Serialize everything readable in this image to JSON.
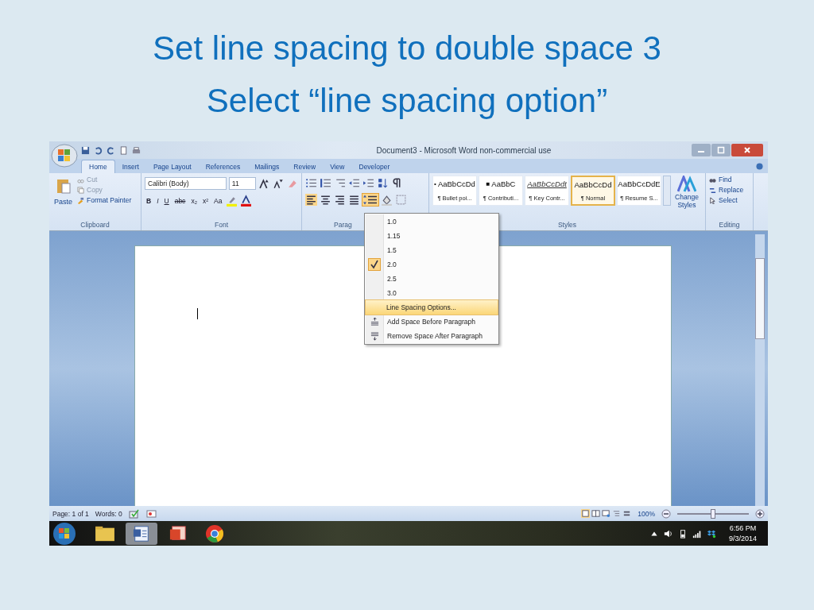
{
  "slide": {
    "title_lines": [
      "Set line spacing to double space 3",
      "Select “line spacing option”"
    ]
  },
  "window": {
    "title": "Document3 - Microsoft Word non-commercial use"
  },
  "ribbon_tabs": [
    {
      "label": "Home",
      "selected": true
    },
    {
      "label": "Insert",
      "selected": false
    },
    {
      "label": "Page Layout",
      "selected": false
    },
    {
      "label": "References",
      "selected": false
    },
    {
      "label": "Mailings",
      "selected": false
    },
    {
      "label": "Review",
      "selected": false
    },
    {
      "label": "View",
      "selected": false
    },
    {
      "label": "Developer",
      "selected": false
    }
  ],
  "clipboard": {
    "paste": "Paste",
    "cut": "Cut",
    "copy": "Copy",
    "format_painter": "Format Painter",
    "label": "Clipboard"
  },
  "font": {
    "font_name": "Calibri (Body)",
    "font_size": "11",
    "format_buttons": [
      "B",
      "I",
      "U",
      "abc",
      "x₂",
      "x²",
      "Aa"
    ],
    "label": "Font"
  },
  "paragraph": {
    "label": "Parag"
  },
  "styles": {
    "items": [
      {
        "marker": "•",
        "preview": "AaBbCcDd",
        "name": "¶ Bullet poi...",
        "kind": "plain",
        "selected": false
      },
      {
        "marker": "■",
        "preview": "AaBbC",
        "name": "¶ Contributi...",
        "kind": "plain",
        "selected": false
      },
      {
        "preview": "AaBbCcDdt",
        "name": "¶ Key Contr...",
        "kind": "emphasis",
        "selected": false
      },
      {
        "preview": "AaBbCcDd",
        "name": "¶ Normal",
        "kind": "plain",
        "selected": true
      },
      {
        "preview": "AaBbCcDdE",
        "name": "¶ Resume S...",
        "kind": "plain",
        "selected": false
      }
    ],
    "change_styles": "Change Styles",
    "label": "Styles"
  },
  "editing": {
    "find": "Find",
    "replace": "Replace",
    "select": "Select",
    "label": "Editing"
  },
  "line_spacing_menu": [
    {
      "kind": "value",
      "label": "1.0",
      "checked": false
    },
    {
      "kind": "value",
      "label": "1.15",
      "checked": false
    },
    {
      "kind": "value",
      "label": "1.5",
      "checked": false
    },
    {
      "kind": "value",
      "label": "2.0",
      "checked": true
    },
    {
      "kind": "value",
      "label": "2.5",
      "checked": false
    },
    {
      "kind": "value",
      "label": "3.0",
      "checked": false
    },
    {
      "kind": "option",
      "label": "Line Spacing Options...",
      "selected": true
    },
    {
      "kind": "add",
      "label": "Add Space Before Paragraph",
      "selected": false
    },
    {
      "kind": "remove",
      "label": "Remove Space After Paragraph",
      "selected": false
    }
  ],
  "status_bar": {
    "page": "Page: 1 of 1",
    "words": "Words: 0",
    "zoom": "100%",
    "zoom_slider": {
      "level": 0.5
    }
  },
  "taskbar": {
    "time": "6:56 PM",
    "date": "9/3/2014"
  }
}
